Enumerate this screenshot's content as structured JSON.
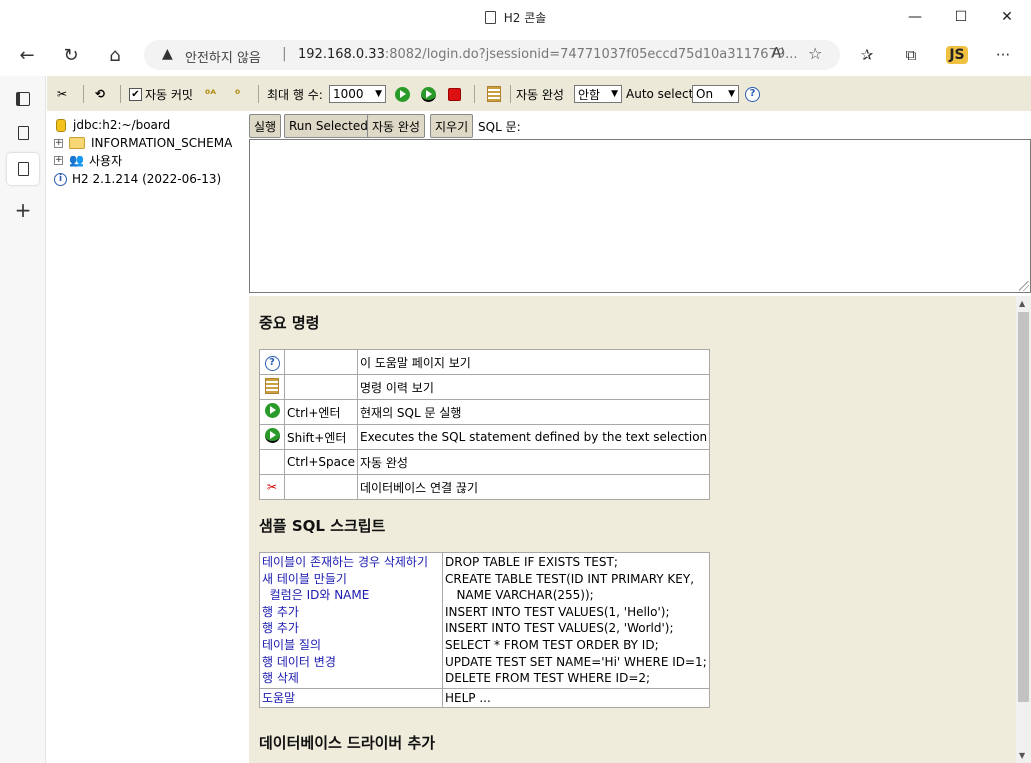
{
  "window": {
    "title": "H2 콘솔",
    "minimize": "—",
    "maximize": "☐",
    "close": "✕"
  },
  "browser": {
    "security_label": "안전하지 않음",
    "url_host": "192.168.0.33",
    "url_rest": ":8082/login.do?jsessionid=74771037f05eccd75d10a3117679...",
    "read_aloud": "A⁾",
    "extension_badge": "JS",
    "more": "···"
  },
  "toolbar": {
    "autocommit_label": "자동 커밋",
    "autocommit_checked": true,
    "max_rows_label": "최대 행 수:",
    "max_rows_value": "1000",
    "autocomplete_label": "자동 완성",
    "autocomplete_value": "안함",
    "autoselect_label": "Auto select",
    "autoselect_value": "On"
  },
  "tree": {
    "connection": "jdbc:h2:~/board",
    "schema": "INFORMATION_SCHEMA",
    "users": "사용자",
    "version": "H2 2.1.214 (2022-06-13)"
  },
  "query": {
    "run_button": "실행",
    "run_selected_button": "Run Selected",
    "autocomplete_button": "자동 완성",
    "clear_button": "지우기",
    "sql_label": "SQL 문:",
    "sql_text": ""
  },
  "help": {
    "important_heading": "중요 명령",
    "commands": [
      {
        "icon": "help-icon",
        "key": "",
        "desc": "이 도움말 페이지 보기"
      },
      {
        "icon": "history-icon",
        "key": "",
        "desc": "명령 이력 보기"
      },
      {
        "icon": "run-icon",
        "key": "Ctrl+엔터",
        "desc": "현재의 SQL 문 실행"
      },
      {
        "icon": "run-selected-icon",
        "key": "Shift+엔터",
        "desc": "Executes the SQL statement defined by the text selection"
      },
      {
        "icon": "",
        "key": "Ctrl+Space",
        "desc": "자동 완성"
      },
      {
        "icon": "disconnect-icon",
        "key": "",
        "desc": "데이터베이스 연결 끊기"
      }
    ],
    "sample_heading": "샘플 SQL 스크립트",
    "sample_links": [
      "테이블이 존재하는 경우 삭제하기",
      "새 테이블 만들기",
      "  컬럼은 ID와 NAME",
      "행 추가",
      "행 추가",
      "테이블 질의",
      "행 데이터 변경",
      "행 삭제"
    ],
    "sample_sql": [
      "DROP TABLE IF EXISTS TEST;",
      "CREATE TABLE TEST(ID INT PRIMARY KEY,",
      "   NAME VARCHAR(255));",
      "INSERT INTO TEST VALUES(1, 'Hello');",
      "INSERT INTO TEST VALUES(2, 'World');",
      "SELECT * FROM TEST ORDER BY ID;",
      "UPDATE TEST SET NAME='Hi' WHERE ID=1;",
      "DELETE FROM TEST WHERE ID=2;"
    ],
    "help_link": "도움말",
    "help_sql": "HELP ...",
    "driver_heading": "데이터베이스 드라이버 추가"
  }
}
